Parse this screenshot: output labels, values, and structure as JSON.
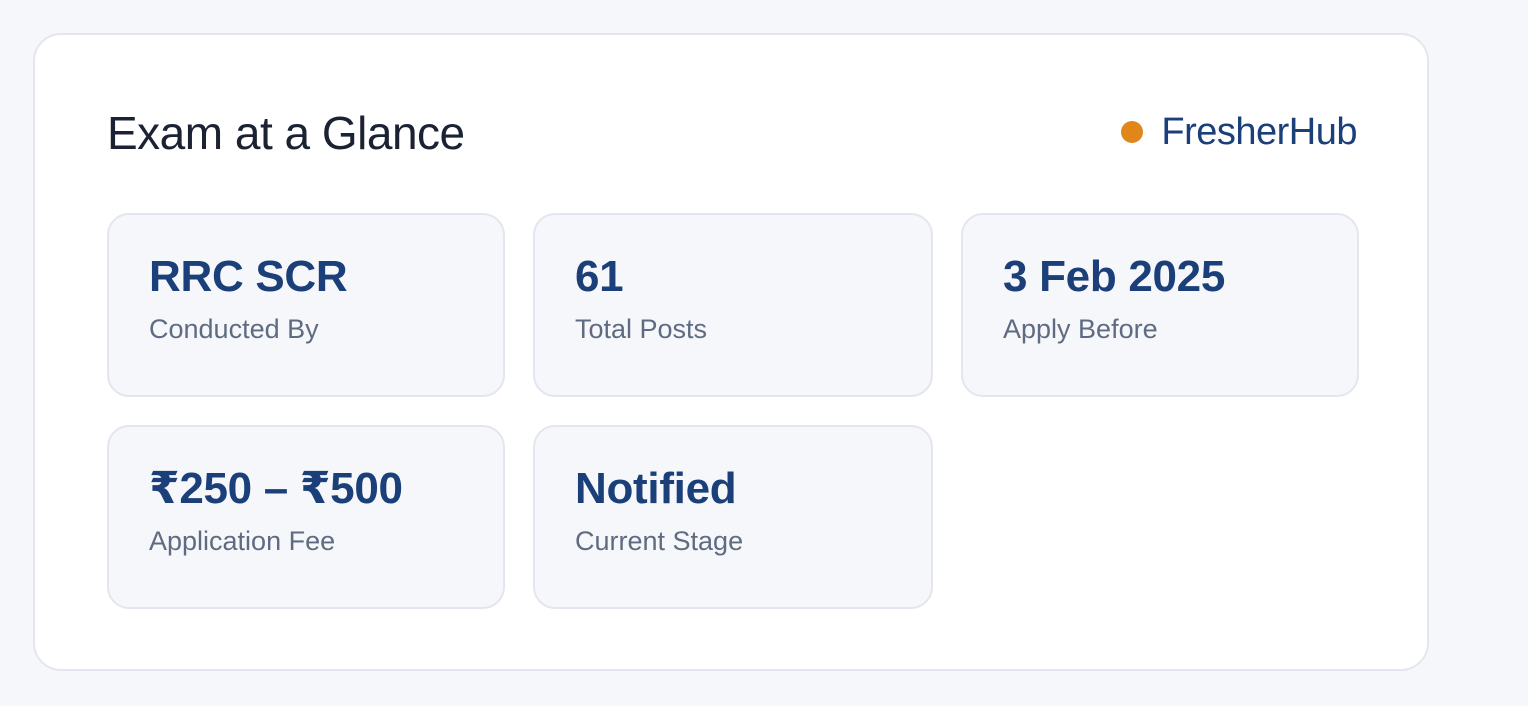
{
  "header": {
    "title": "Exam at a Glance",
    "brand_name": "FresherHub",
    "brand_dot_color": "#e0861b"
  },
  "tiles": [
    {
      "value": "RRC SCR",
      "label": "Conducted By"
    },
    {
      "value": "61",
      "label": "Total Posts"
    },
    {
      "value": "3 Feb 2025",
      "label": "Apply Before"
    },
    {
      "value": "₹250 – ₹500",
      "label": "Application Fee"
    },
    {
      "value": "Notified",
      "label": "Current Stage"
    }
  ],
  "colors": {
    "accent": "#1b3f78",
    "muted_text": "#5f6b80",
    "title_text": "#1b2233",
    "page_background": "#f6f7fb",
    "card_background": "#ffffff",
    "border": "#e3e6ee"
  }
}
